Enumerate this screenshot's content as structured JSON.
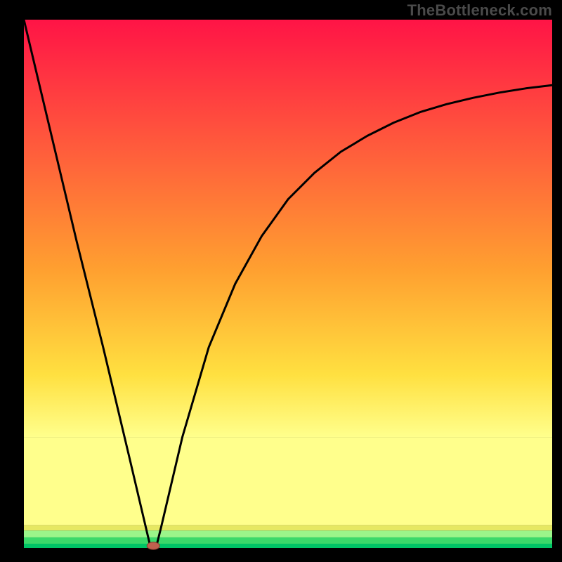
{
  "watermark": "TheBottleneck.com",
  "colors": {
    "frame": "#000000",
    "top": "#ff1446",
    "band_yellow_light": "#ffff8c",
    "band_yellow_dark": "#e6e862",
    "band_green_light": "#9bf58a",
    "band_green_mid": "#3bd96a",
    "band_green_dark": "#00c466",
    "curve": "#000000",
    "marker_fill": "#c0604e",
    "marker_stroke": "#8a3a2c"
  },
  "chart_data": {
    "type": "line",
    "title": "",
    "xlabel": "",
    "ylabel": "",
    "xlim": [
      0,
      100
    ],
    "ylim": [
      0,
      100
    ],
    "grid": false,
    "legend": false,
    "series": [
      {
        "name": "bottleneck-curve",
        "x": [
          0,
          5,
          10,
          15,
          20,
          24,
          25,
          26,
          30,
          35,
          40,
          45,
          50,
          55,
          60,
          65,
          70,
          75,
          80,
          85,
          90,
          95,
          100
        ],
        "y": [
          100,
          79,
          58,
          38,
          17,
          0,
          0,
          4,
          21,
          38,
          50,
          59,
          66,
          71,
          75,
          78,
          80.5,
          82.5,
          84,
          85.2,
          86.2,
          87,
          87.6
        ]
      }
    ],
    "marker": {
      "x": 24.5,
      "y": 0,
      "rx": 1.2,
      "ry": 0.7
    },
    "bands": [
      {
        "name": "green-dark",
        "y_from": 0,
        "y_to": 0.8
      },
      {
        "name": "green-mid",
        "y_from": 0.8,
        "y_to": 2.0
      },
      {
        "name": "green-light",
        "y_from": 2.0,
        "y_to": 3.3
      },
      {
        "name": "yellow-dark",
        "y_from": 3.3,
        "y_to": 4.3
      },
      {
        "name": "yellow-light",
        "y_from": 4.3,
        "y_to": 21
      }
    ],
    "gradient_region": {
      "y_from": 21,
      "y_to": 100
    }
  }
}
